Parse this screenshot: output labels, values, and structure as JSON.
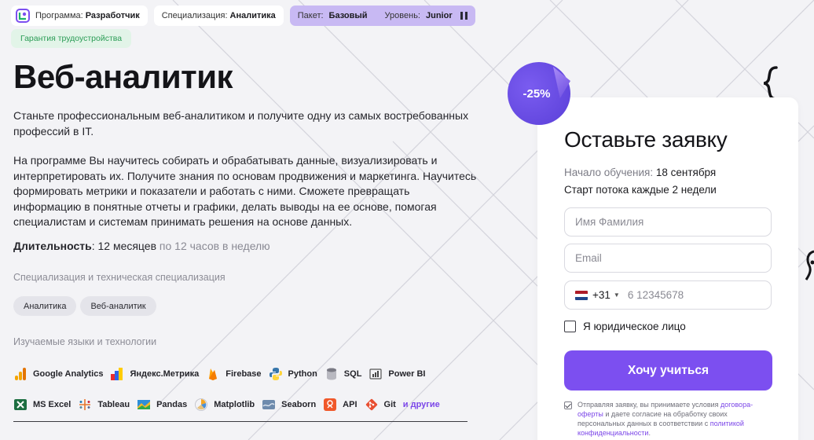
{
  "chips": {
    "program_label": "Программа:",
    "program_value": "Разработчик",
    "spec_label": "Специализация:",
    "spec_value": "Аналитика",
    "package_label": "Пакет:",
    "package_value": "Базовый",
    "level_label": "Уровень:",
    "level_value": "Junior",
    "guarantee": "Гарантия трудоустройства"
  },
  "hero": {
    "title": "Веб-аналитик",
    "intro": "Станьте профессиональным веб-аналитиком и получите одну из самых востребованных профессий в IT.",
    "description": "На программе Вы научитесь собирать и обрабатывать данные, визуализировать и интерпретировать их. Получите знания по основам продвижения и маркетинга. Научитесь формировать метрики и показатели и работать с ними.  Сможете превращать информацию в понятные отчеты и графики, делать выводы на ее основе, помогая специалистам и системам принимать решения на основе данных.",
    "duration_label": "Длительность",
    "duration_value": ": 12 месяцев",
    "duration_note": " по 12 часов в неделю"
  },
  "specializations": {
    "label": "Специализация и техническая специализация",
    "tags": [
      "Аналитика",
      "Веб-аналитик"
    ]
  },
  "technologies": {
    "label": "Изучаемые языки и технологии",
    "row1": [
      {
        "name": "Google Analytics",
        "icon": "google-analytics-icon"
      },
      {
        "name": "Яндекс.Метрика",
        "icon": "yandex-metrika-icon"
      },
      {
        "name": "Firebase",
        "icon": "firebase-icon"
      },
      {
        "name": "Python",
        "icon": "python-icon"
      },
      {
        "name": "SQL",
        "icon": "sql-icon"
      },
      {
        "name": "Power BI",
        "icon": "power-bi-icon"
      }
    ],
    "row2": [
      {
        "name": "MS Excel",
        "icon": "excel-icon"
      },
      {
        "name": "Tableau",
        "icon": "tableau-icon"
      },
      {
        "name": "Pandas",
        "icon": "pandas-icon"
      },
      {
        "name": "Matplotlib",
        "icon": "matplotlib-icon"
      },
      {
        "name": "Seaborn",
        "icon": "seaborn-icon"
      },
      {
        "name": "API",
        "icon": "api-icon"
      },
      {
        "name": "Git",
        "icon": "git-icon"
      }
    ],
    "more": "и другие"
  },
  "discount": "-25%",
  "form": {
    "title": "Оставьте заявку",
    "start_label": "Начало обучения:",
    "start_value": " 18 сентября",
    "flow": "Старт потока каждые 2 недели",
    "name_placeholder": "Имя Фамилия",
    "email_placeholder": "Email",
    "phone_code": "+31",
    "phone_placeholder": "6 12345678",
    "legal_entity": "Я юридическое лицо",
    "submit": "Хочу учиться",
    "consent_1": "Отправляя заявку, вы принимаете условия ",
    "consent_link_1": "договора-оферты",
    "consent_2": " и даете согласие на обработку своих персональных данных в соответствии с ",
    "consent_link_2": "политикой конфиденциальности",
    "consent_3": "."
  },
  "colors": {
    "accent": "#7c4ff0",
    "guarantee_text": "#2b9c56",
    "purple_chip": "#c8b9f3"
  }
}
